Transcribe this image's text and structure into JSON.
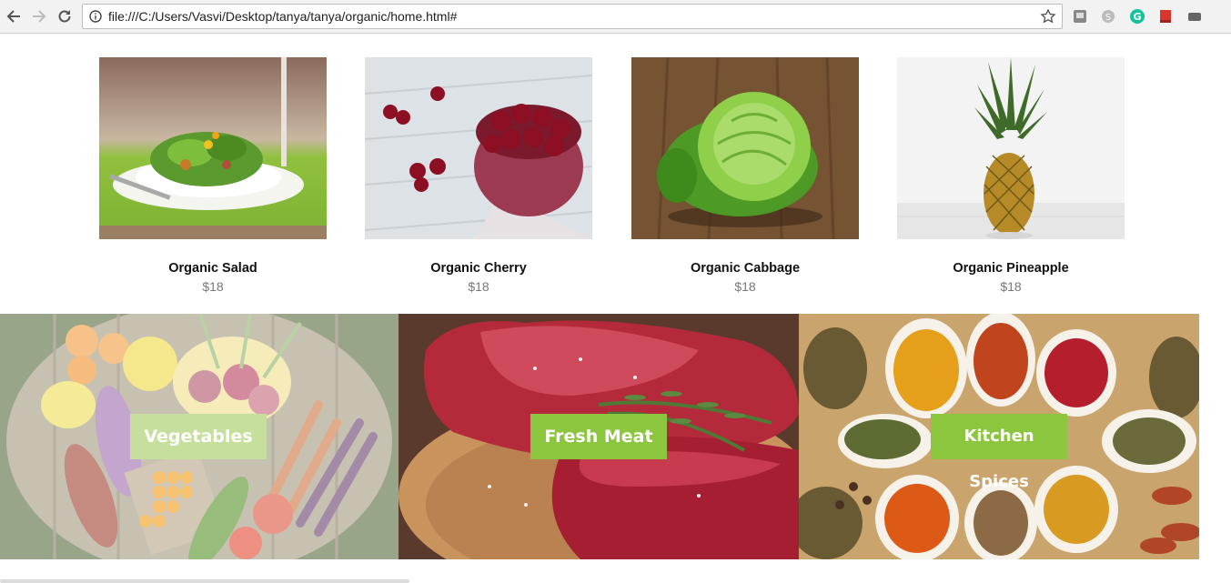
{
  "browser": {
    "url": "file:///C:/Users/Vasvi/Desktop/tanya/tanya/organic/home.html#",
    "icons": [
      "back-arrow-icon",
      "forward-arrow-icon",
      "reload-icon",
      "info-icon",
      "star-icon"
    ],
    "extensions": [
      "pocket-icon",
      "skype-icon",
      "grammarly-icon",
      "bookmark-icon",
      "ext-icon"
    ]
  },
  "products": [
    {
      "name": "Organic Salad",
      "price": "$18"
    },
    {
      "name": "Organic Cherry",
      "price": "$18"
    },
    {
      "name": "Organic Cabbage",
      "price": "$18"
    },
    {
      "name": "Organic Pineapple",
      "price": "$18"
    }
  ],
  "categories": [
    {
      "label": "Vegetables"
    },
    {
      "label": "Fresh Meat"
    },
    {
      "label": "Kitchen Spices"
    }
  ],
  "colors": {
    "accent_green": "#8cc63f",
    "accent_green_faded": "#c7df9c"
  }
}
